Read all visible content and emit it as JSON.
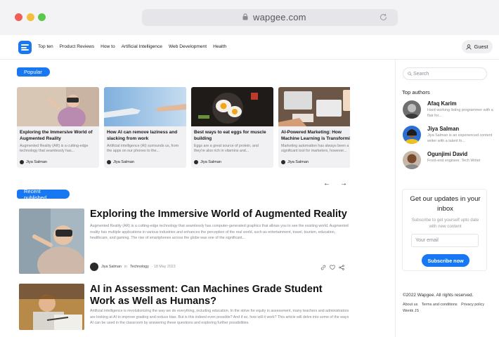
{
  "browser": {
    "url": "wapgee.com"
  },
  "nav": {
    "links": [
      "Top ten",
      "Product Reviews",
      "How to",
      "Artificial Intelligence",
      "Web Development",
      "Health"
    ],
    "guest_label": "Guest"
  },
  "popular": {
    "label": "Popular",
    "cards": [
      {
        "title": "Exploring the Immersive World of Augmented Reality",
        "excerpt": "Augmented Reality (AR) is a cutting-edge technology that seamlessly has...",
        "author": "Jiya Salman"
      },
      {
        "title": "How AI can remove laziness and slacking from work",
        "excerpt": "Artificial intelligence (AI) surrounds us, from the apps on our phones to the...",
        "author": "Jiya Salman"
      },
      {
        "title": "Best ways to eat eggs for muscle building",
        "excerpt": "Eggs are a great source of protein, and they're also rich in vitamins and...",
        "author": "Jiya Salman"
      },
      {
        "title": "AI-Powered Marketing: How Machine Learning is Transforming",
        "excerpt": "Marketing automation has always been a significant tool for marketers, however...",
        "author": "Jiya Salman"
      }
    ]
  },
  "recent": {
    "label": "Recent published",
    "articles": [
      {
        "title": "Exploring the Immersive World of Augmented Reality",
        "excerpt": "Augmented Reality (AR) is a cutting-edge technology that seamlessly has computer-generated graphics that allows you to see the existing world. Augmented reality has multiple applications in various industries and enhances the perception of the real world, such as entertainment, travel, tourism, education, healthcare, and gaming. The rise of smartphones across the globe was one of the significant...",
        "author": "Jiya Salman",
        "category_prefix": "in",
        "category": "Technology",
        "date": "· 18 May 2023"
      },
      {
        "title": "AI in Assessment: Can Machines Grade Student Work as Well as Humans?",
        "excerpt": "Artificial intelligence is revolutionizing the way we do everything, including education. In the strive for equity in assessment, many teachers and administrators are looking at AI to improve grading and reduce bias. But is this indeed even possible? And if so, how will it work? This article will delve into some of the ways AI can be used in the classroom by answering these questions and exploring further possibilities."
      }
    ]
  },
  "sidebar": {
    "search_placeholder": "Search",
    "top_authors_title": "Top authors",
    "authors": [
      {
        "name": "Afaq Karim",
        "desc": "Hard-working listing programmer with a flair for..."
      },
      {
        "name": "Jiya Salman",
        "desc": "Jiya Salman is an experienced content writer with a talent fo..."
      },
      {
        "name": "Ogunjimi David",
        "desc": "Front-end engineer. Tech Writer"
      }
    ],
    "newsletter": {
      "title": "Get our updates in your inbox",
      "subtitle": "Subscribe to get yourself upto date with new content",
      "email_placeholder": "Your email",
      "button": "Subscribe now"
    },
    "footer": {
      "copyright": "©2022 Wapgee. All rights reserved.",
      "links": [
        "About us",
        "Terms and conditions",
        "Privacy policy",
        "Wentk JS"
      ]
    }
  },
  "colors": {
    "accent": "#1877f2"
  }
}
